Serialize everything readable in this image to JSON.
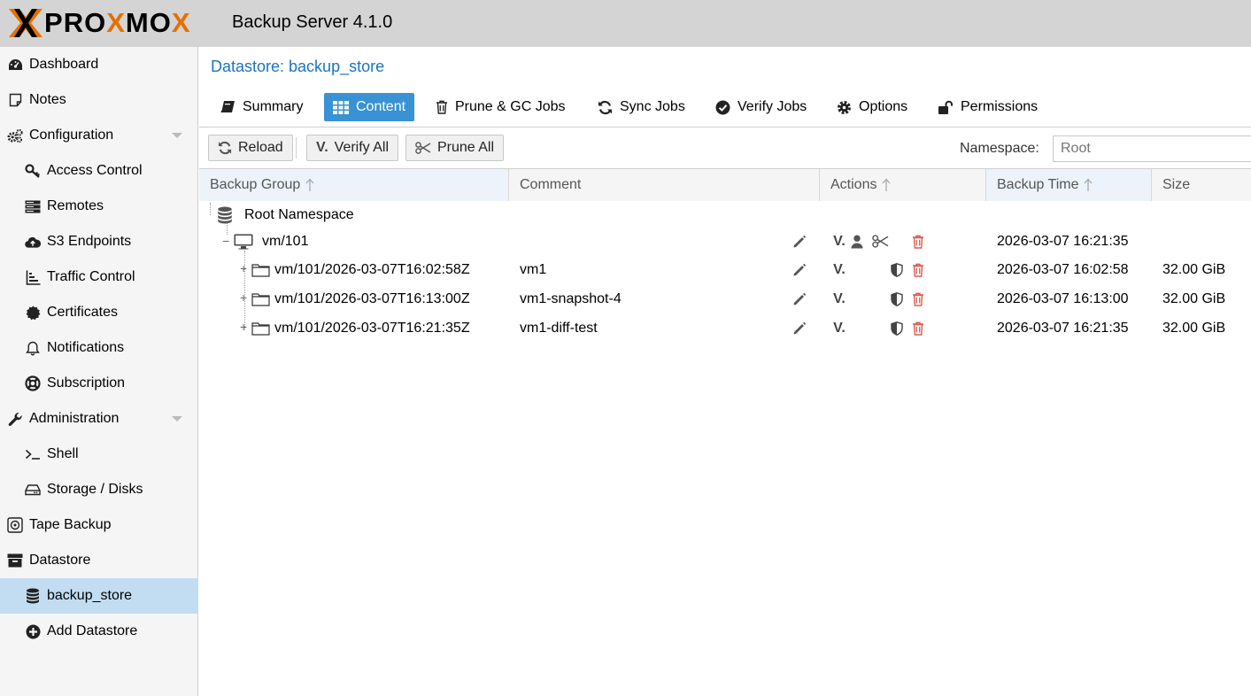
{
  "header": {
    "logo_text": "PROXMOX",
    "app_title": "Backup Server 4.1.0"
  },
  "sidebar": {
    "items": [
      {
        "label": "Dashboard",
        "icon": "dashboard-icon"
      },
      {
        "label": "Notes",
        "icon": "notes-icon"
      },
      {
        "label": "Configuration",
        "icon": "gears-icon"
      },
      {
        "label": "Access Control",
        "icon": "key-icon"
      },
      {
        "label": "Remotes",
        "icon": "server-icon"
      },
      {
        "label": "S3 Endpoints",
        "icon": "cloud-upload-icon"
      },
      {
        "label": "Traffic Control",
        "icon": "traffic-icon"
      },
      {
        "label": "Certificates",
        "icon": "certificate-icon"
      },
      {
        "label": "Notifications",
        "icon": "bell-icon"
      },
      {
        "label": "Subscription",
        "icon": "support-icon"
      },
      {
        "label": "Administration",
        "icon": "wrench-icon"
      },
      {
        "label": "Shell",
        "icon": "terminal-icon"
      },
      {
        "label": "Storage / Disks",
        "icon": "hdd-icon"
      },
      {
        "label": "Tape Backup",
        "icon": "tape-icon"
      },
      {
        "label": "Datastore",
        "icon": "archive-icon"
      },
      {
        "label": "backup_store",
        "icon": "database-icon"
      },
      {
        "label": "Add Datastore",
        "icon": "plus-circle-icon"
      }
    ]
  },
  "panel": {
    "title": "Datastore: backup_store"
  },
  "tabs": [
    {
      "label": "Summary",
      "icon": "book-icon"
    },
    {
      "label": "Content",
      "icon": "grid-icon"
    },
    {
      "label": "Prune & GC Jobs",
      "icon": "trash-icon"
    },
    {
      "label": "Sync Jobs",
      "icon": "refresh-icon"
    },
    {
      "label": "Verify Jobs",
      "icon": "check-circle-icon"
    },
    {
      "label": "Options",
      "icon": "gear-icon"
    },
    {
      "label": "Permissions",
      "icon": "unlock-icon"
    }
  ],
  "toolbar": {
    "reload": "Reload",
    "verify_all": "Verify All",
    "prune_all": "Prune All",
    "namespace_label": "Namespace:",
    "namespace_placeholder": "Root"
  },
  "columns": {
    "backup_group": "Backup Group",
    "comment": "Comment",
    "actions": "Actions",
    "backup_time": "Backup Time",
    "size": "Size"
  },
  "verify_glyph": "V.",
  "rows": [
    {
      "name": "Root Namespace",
      "comment": "",
      "time": "",
      "size": ""
    },
    {
      "name": "vm/101",
      "comment": "",
      "time": "2026-03-07 16:21:35",
      "size": ""
    },
    {
      "name": "vm/101/2026-03-07T16:02:58Z",
      "comment": "vm1",
      "time": "2026-03-07 16:02:58",
      "size": "32.00 GiB"
    },
    {
      "name": "vm/101/2026-03-07T16:13:00Z",
      "comment": "vm1-snapshot-4",
      "time": "2026-03-07 16:13:00",
      "size": "32.00 GiB"
    },
    {
      "name": "vm/101/2026-03-07T16:21:35Z",
      "comment": "vm1-diff-test",
      "time": "2026-03-07 16:21:35",
      "size": "32.00 GiB"
    }
  ],
  "colors": {
    "accent": "#3892d4",
    "title_blue": "#1b74c0",
    "logo_orange": "#e57000",
    "delete_red": "#e05a4f",
    "selected_nav": "#c2ddf2"
  }
}
